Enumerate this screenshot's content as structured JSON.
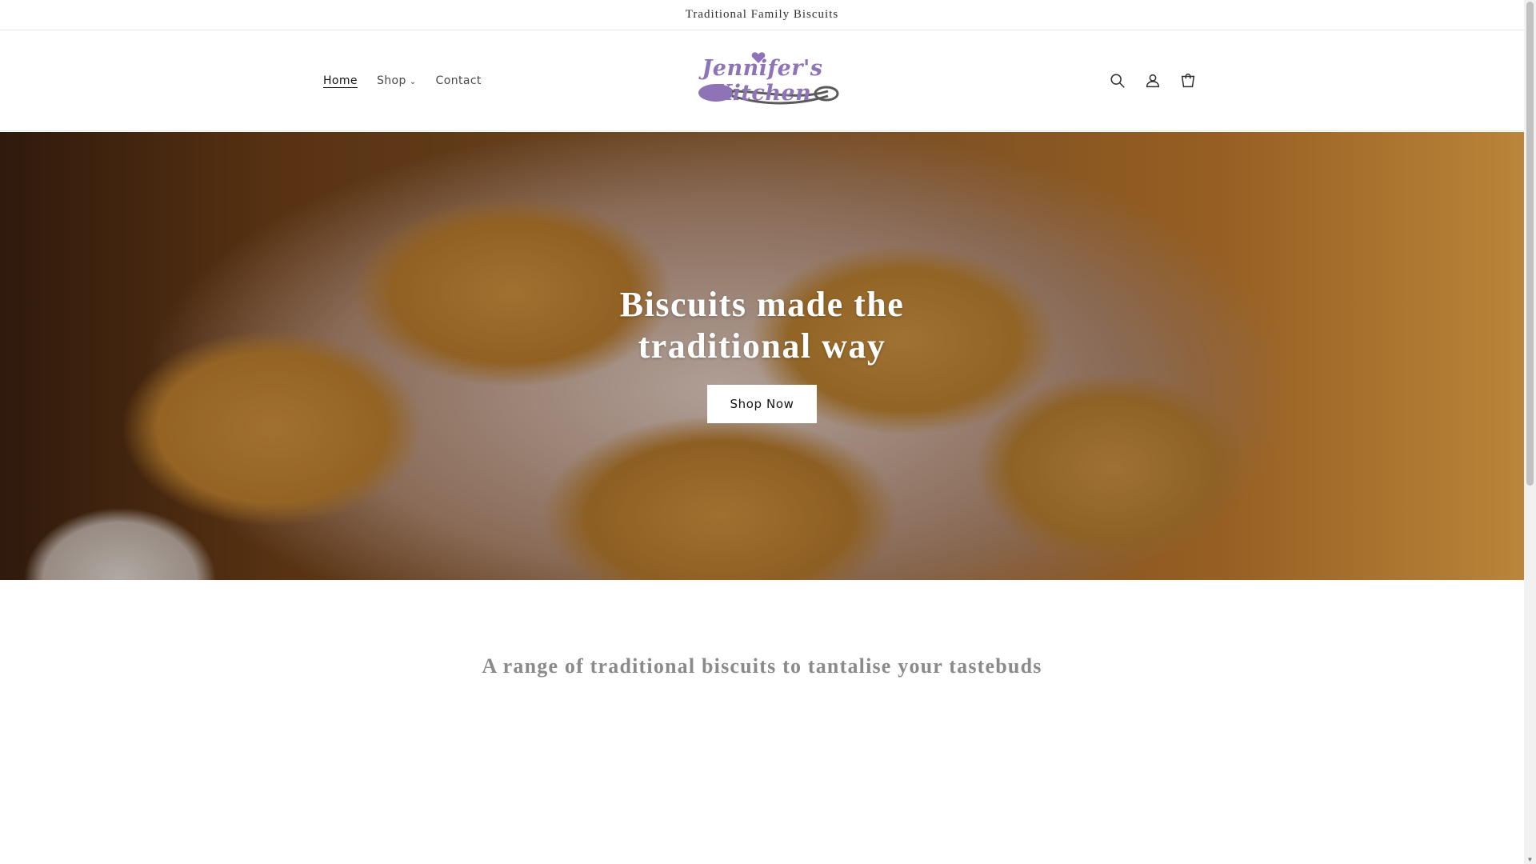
{
  "announcement": {
    "text": "Traditional Family Biscuits"
  },
  "nav": {
    "items": [
      {
        "label": "Home"
      },
      {
        "label": "Shop"
      },
      {
        "label": "Contact"
      }
    ]
  },
  "logo": {
    "text": "Jennifer's Kitchen"
  },
  "header_icons": [
    "search-icon",
    "account-icon",
    "cart-icon"
  ],
  "hero": {
    "title": "Biscuits made the traditional way",
    "button_label": "Shop Now"
  },
  "tagline": "A range of traditional biscuits to tantalise your tastebuds",
  "colors": {
    "logo_purple": "#8e73b7",
    "text_dark": "#121212",
    "tagline_grey": "#8a8a8a"
  }
}
